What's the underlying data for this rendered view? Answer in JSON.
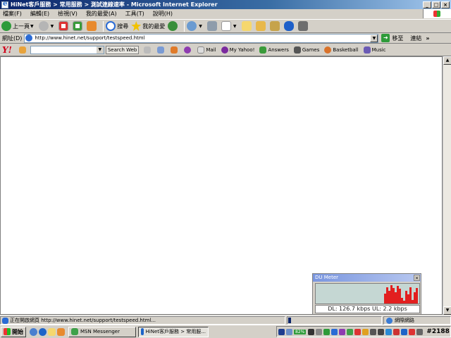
{
  "window": {
    "title": "HiNet客戶服務 > 常用服務 > 測試連線速率 - Microsoft Internet Explorer",
    "min_label": "_",
    "max_label": "□",
    "close_label": "×"
  },
  "menubar": {
    "items": [
      "檔案(F)",
      "編輯(E)",
      "檢視(V)",
      "我的最愛(A)",
      "工具(T)",
      "說明(H)"
    ]
  },
  "toolbar": {
    "back_label": "上一頁",
    "search_label": "搜尋",
    "favorites_label": "我的最愛"
  },
  "addressbar": {
    "label": "網址(D)",
    "url": "http://www.hinet.net/support/testspeed.html",
    "go_label": "移至",
    "links_label": "連結",
    "chevron": "»"
  },
  "yahoo_toolbar": {
    "logo": "Y!",
    "search_value": "",
    "search_web_label": "Search Web",
    "items": [
      "Mail",
      "My Yahoo!",
      "Answers",
      "Games",
      "Basketball",
      "Music"
    ]
  },
  "dumeter": {
    "title": "DU Meter",
    "readout": "DL: 126.7 kbps  UL: 2.2 kbps",
    "graph_levels": [
      0.55,
      0.9,
      0.7,
      1.0,
      0.85,
      0.6,
      0.95,
      0.8,
      0.3,
      0.15,
      0.7,
      0.5,
      0.9,
      0.2,
      0.6,
      0.85
    ],
    "graph_color": "#e21f1f",
    "background_color": "#c5d7d3"
  },
  "statusbar": {
    "text": "正在開啟網頁 http://www.hinet.net/support/testspeed.html...",
    "progress": 0.03,
    "zone_label": "網際網路"
  },
  "taskbar": {
    "start_label": "開始",
    "tasks": [
      {
        "label": "MSN Messenger",
        "active": false
      },
      {
        "label": "HiNet客戶服務 > 常用服...",
        "active": true
      }
    ],
    "battery_label": "82%",
    "clock_label": "#2188"
  }
}
